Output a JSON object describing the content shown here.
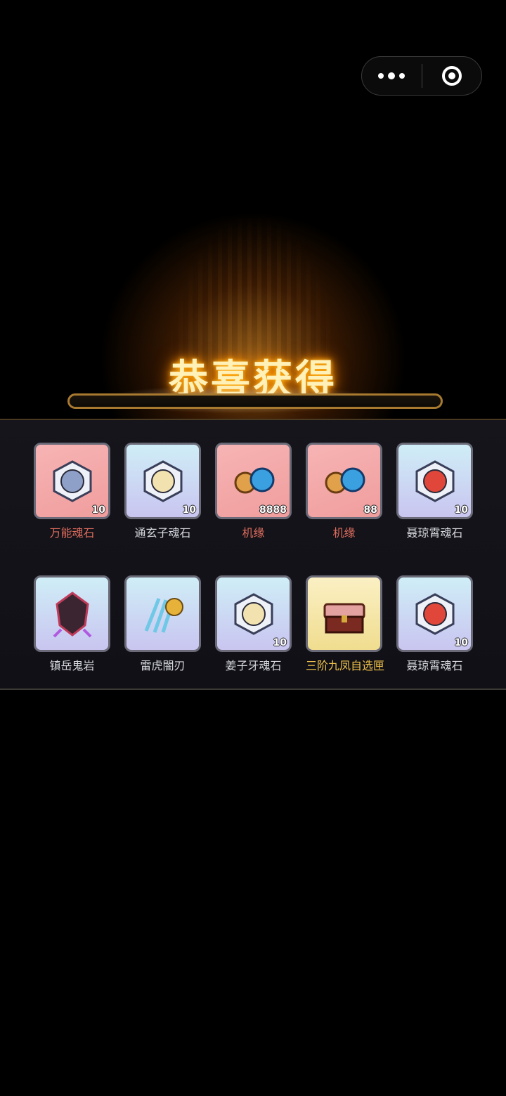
{
  "capsule": {
    "more_icon": "more-dots-icon",
    "close_icon": "target-close-icon"
  },
  "title": "恭喜获得",
  "items_row1": [
    {
      "name": "万能魂石",
      "count": "10",
      "bg": "pink",
      "label_color": "red",
      "icon": "universal-soul-stone-icon"
    },
    {
      "name": "通玄子魂石",
      "count": "10",
      "bg": "cyan",
      "label_color": "grey",
      "icon": "tongxuanzi-soul-stone-icon"
    },
    {
      "name": "机缘",
      "count": "8888",
      "bg": "pink",
      "label_color": "red",
      "icon": "fortune-cloud-icon"
    },
    {
      "name": "机缘",
      "count": "88",
      "bg": "pink",
      "label_color": "red",
      "icon": "fortune-cloud-icon"
    },
    {
      "name": "聂琼霄魂石",
      "count": "10",
      "bg": "cyan",
      "label_color": "grey",
      "icon": "nie-qiongxiao-soul-stone-icon"
    }
  ],
  "items_row2": [
    {
      "name": "镇岳鬼岩",
      "count": "",
      "bg": "cyan",
      "label_color": "grey",
      "icon": "demon-rock-icon"
    },
    {
      "name": "雷虎闇刃",
      "count": "",
      "bg": "cyan",
      "label_color": "grey",
      "icon": "tiger-claw-blade-icon"
    },
    {
      "name": "姜子牙魂石",
      "count": "10",
      "bg": "cyan",
      "label_color": "grey",
      "icon": "jiangziya-soul-stone-icon"
    },
    {
      "name": "三阶九凤自选匣",
      "count": "",
      "bg": "gold",
      "label_color": "gold",
      "icon": "treasure-chest-icon"
    },
    {
      "name": "聂琼霄魂石",
      "count": "10",
      "bg": "cyan",
      "label_color": "grey",
      "icon": "nie-qiongxiao-soul-stone-icon"
    }
  ],
  "items_row3_bgs": [
    "pink",
    "pink",
    "pink",
    "gold",
    "cyan"
  ]
}
